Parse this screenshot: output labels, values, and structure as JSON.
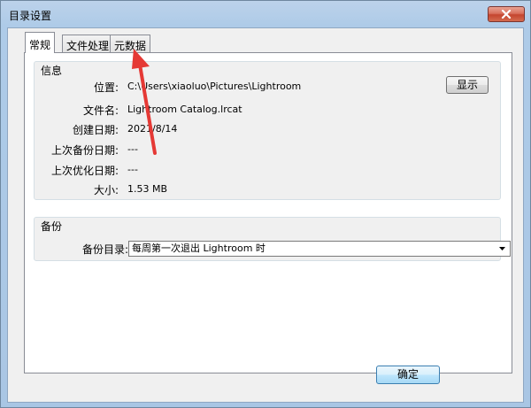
{
  "window": {
    "title": "目录设置"
  },
  "tabs": [
    {
      "label": "常规",
      "active": true
    },
    {
      "label": "文件处理",
      "active": false
    },
    {
      "label": "元数据",
      "active": false
    }
  ],
  "info_group": {
    "title": "信息",
    "rows": [
      {
        "label": "位置:",
        "value": "C:\\Users\\xiaoluo\\Pictures\\Lightroom"
      },
      {
        "label": "文件名:",
        "value": "Lightroom Catalog.lrcat"
      },
      {
        "label": "创建日期:",
        "value": "2021/8/14"
      },
      {
        "label": "上次备份日期:",
        "value": "---"
      },
      {
        "label": "上次优化日期:",
        "value": "---"
      },
      {
        "label": "大小:",
        "value": "1.53 MB"
      }
    ],
    "show_button": "显示"
  },
  "backup_group": {
    "title": "备份",
    "dir_label": "备份目录:",
    "selected": "每周第一次退出 Lightroom 时"
  },
  "buttons": {
    "ok": "确定"
  },
  "colors": {
    "annotation_arrow": "#e53935",
    "ok_border": "#3c7fb1"
  }
}
